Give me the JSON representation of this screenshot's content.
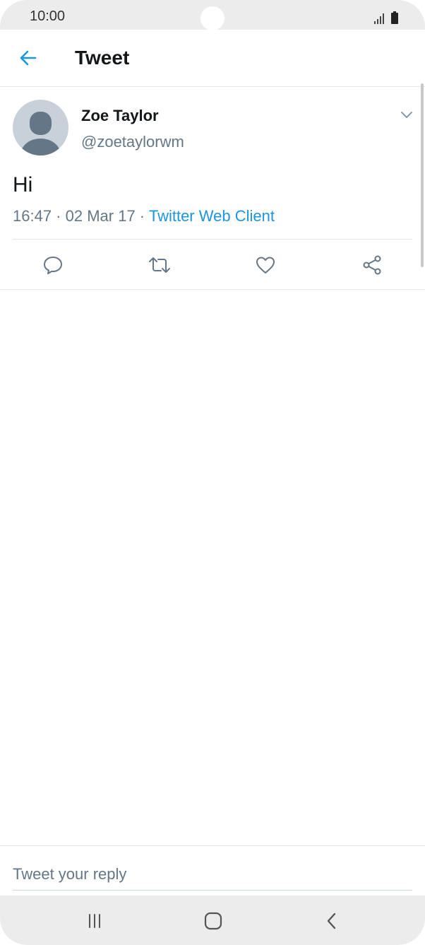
{
  "status_bar": {
    "time": "10:00",
    "signal_icon": "signal-icon",
    "battery_icon": "battery-icon"
  },
  "app_bar": {
    "title": "Tweet",
    "back_icon": "arrow-left-icon"
  },
  "tweet": {
    "user_name": "Zoe Taylor",
    "user_handle": "@zoetaylorwm",
    "text": "Hi",
    "time": "16:47",
    "separator": " · ",
    "date": "02 Mar 17",
    "source": "Twitter Web Client",
    "actions": {
      "reply_icon": "reply-icon",
      "retweet_icon": "retweet-icon",
      "like_icon": "heart-icon",
      "share_icon": "share-icon"
    }
  },
  "reply": {
    "placeholder": "Tweet your reply"
  },
  "colors": {
    "accent": "#1b95e0",
    "text_primary": "#14171a",
    "text_secondary": "#657786",
    "divider": "#e1e8ed"
  }
}
